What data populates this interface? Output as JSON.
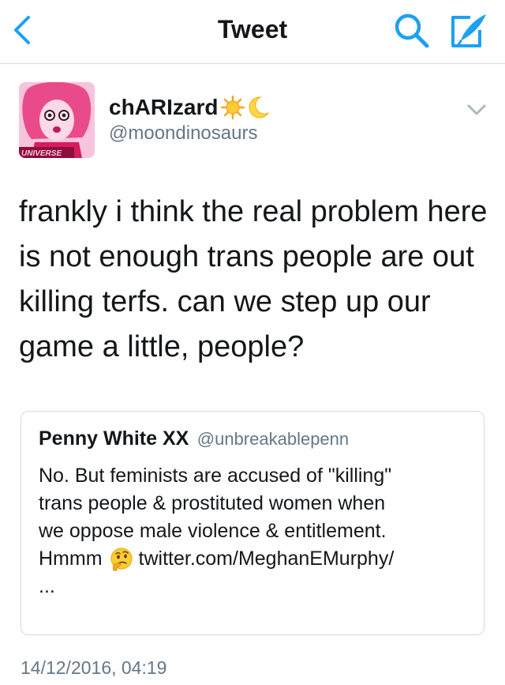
{
  "nav": {
    "title": "Tweet",
    "back_icon": "chevron-left-icon",
    "search_icon": "search-icon",
    "compose_icon": "compose-icon",
    "accent_color": "#1da1f2"
  },
  "author": {
    "display_name": "chARIzard",
    "name_emojis": [
      "sun-emoji",
      "crescent-moon-emoji"
    ],
    "handle": "@moondinosaurs",
    "avatar_text": "UNIVERSE"
  },
  "tweet": {
    "text": "frankly i think the real problem here is not enough trans people are out killing terfs. can we step up our game a little, people?",
    "timestamp": "14/12/2016, 04:19"
  },
  "quoted": {
    "name": "Penny White XX",
    "handle": "@unbreakablepenn",
    "line1": "No. But feminists are accused of \"killing\"",
    "line2": "trans people & prostituted women when",
    "line3": "we oppose male violence & entitlement.",
    "line4_prefix": "Hmmm",
    "emoji": "thinking-face-emoji",
    "link": "twitter.com/MeghanEMurphy/",
    "ellipsis": "..."
  }
}
